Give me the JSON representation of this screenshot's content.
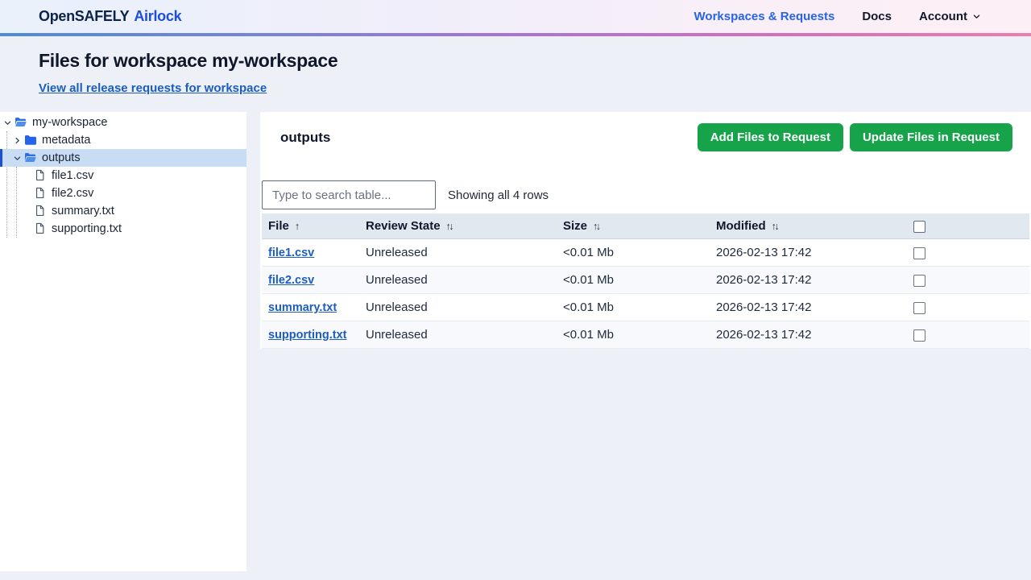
{
  "nav": {
    "brand_primary": "OpenSAFELY",
    "brand_secondary": "Airlock",
    "links": [
      {
        "label": "Workspaces & Requests"
      },
      {
        "label": "Docs"
      }
    ],
    "account_label": "Account"
  },
  "header": {
    "title": "Files for workspace my-workspace",
    "link": "View all release requests for workspace"
  },
  "tree": {
    "items": [
      {
        "label": "my-workspace",
        "type": "folder-open",
        "level": 0,
        "expanded": true,
        "selected": false
      },
      {
        "label": "metadata",
        "type": "folder-closed",
        "level": 1,
        "expanded": false,
        "selected": false
      },
      {
        "label": "outputs",
        "type": "folder-open",
        "level": 1,
        "expanded": true,
        "selected": true
      },
      {
        "label": "file1.csv",
        "type": "file",
        "level": 2,
        "selected": false
      },
      {
        "label": "file2.csv",
        "type": "file",
        "level": 2,
        "selected": false
      },
      {
        "label": "summary.txt",
        "type": "file",
        "level": 2,
        "selected": false
      },
      {
        "label": "supporting.txt",
        "type": "file",
        "level": 2,
        "selected": false
      }
    ]
  },
  "main": {
    "title": "outputs",
    "buttons": {
      "add": "Add Files to Request",
      "update": "Update Files in Request"
    },
    "search_placeholder": "Type to search table...",
    "showing": "Showing all 4 rows",
    "table": {
      "columns": [
        {
          "label": "File",
          "sort_state": "asc",
          "sort_glyph": "↑"
        },
        {
          "label": "Review State",
          "sort_state": "unsorted",
          "sort_glyph": "↑↓"
        },
        {
          "label": "Size",
          "sort_state": "unsorted",
          "sort_glyph": "↑↓"
        },
        {
          "label": "Modified",
          "sort_state": "unsorted",
          "sort_glyph": "↑↓"
        }
      ],
      "select_all_checked": false,
      "rows": [
        {
          "file": "file1.csv",
          "review_state": "Unreleased",
          "size": "<0.01 Mb",
          "modified": "2026-02-13 17:42",
          "checked": false
        },
        {
          "file": "file2.csv",
          "review_state": "Unreleased",
          "size": "<0.01 Mb",
          "modified": "2026-02-13 17:42",
          "checked": false
        },
        {
          "file": "summary.txt",
          "review_state": "Unreleased",
          "size": "<0.01 Mb",
          "modified": "2026-02-13 17:42",
          "checked": false
        },
        {
          "file": "supporting.txt",
          "review_state": "Unreleased",
          "size": "<0.01 Mb",
          "modified": "2026-02-13 17:42",
          "checked": false
        }
      ]
    }
  },
  "icons": {
    "chevron-down-icon": "˅",
    "chevron-right-icon": "›",
    "folder-open-icon": "open blue folder",
    "folder-closed-icon": "solid blue folder",
    "file-icon": "document page outline",
    "sort-asc-icon": "↑",
    "sort-unsorted-icon": "↑↓",
    "checkbox": "empty square"
  },
  "colors": {
    "page_bg": "#edf1f7",
    "panel_bg": "#ffffff",
    "accent_green": "#16a34a",
    "link_blue": "#1d5dbe",
    "nav_link_blue": "#2563eb",
    "brand_navy": "#0c2249",
    "brand_blue": "#1d4ed8",
    "tree_selection_bg": "#c8dcf4",
    "tree_selection_bar": "#1d4ed8",
    "table_header_bg": "#e2e8f0",
    "row_alt_bg": "#f7f9fc",
    "gradient_left": "#4e8bd6",
    "gradient_mid": "#ab74d0",
    "gradient_right": "#ee7cab"
  }
}
